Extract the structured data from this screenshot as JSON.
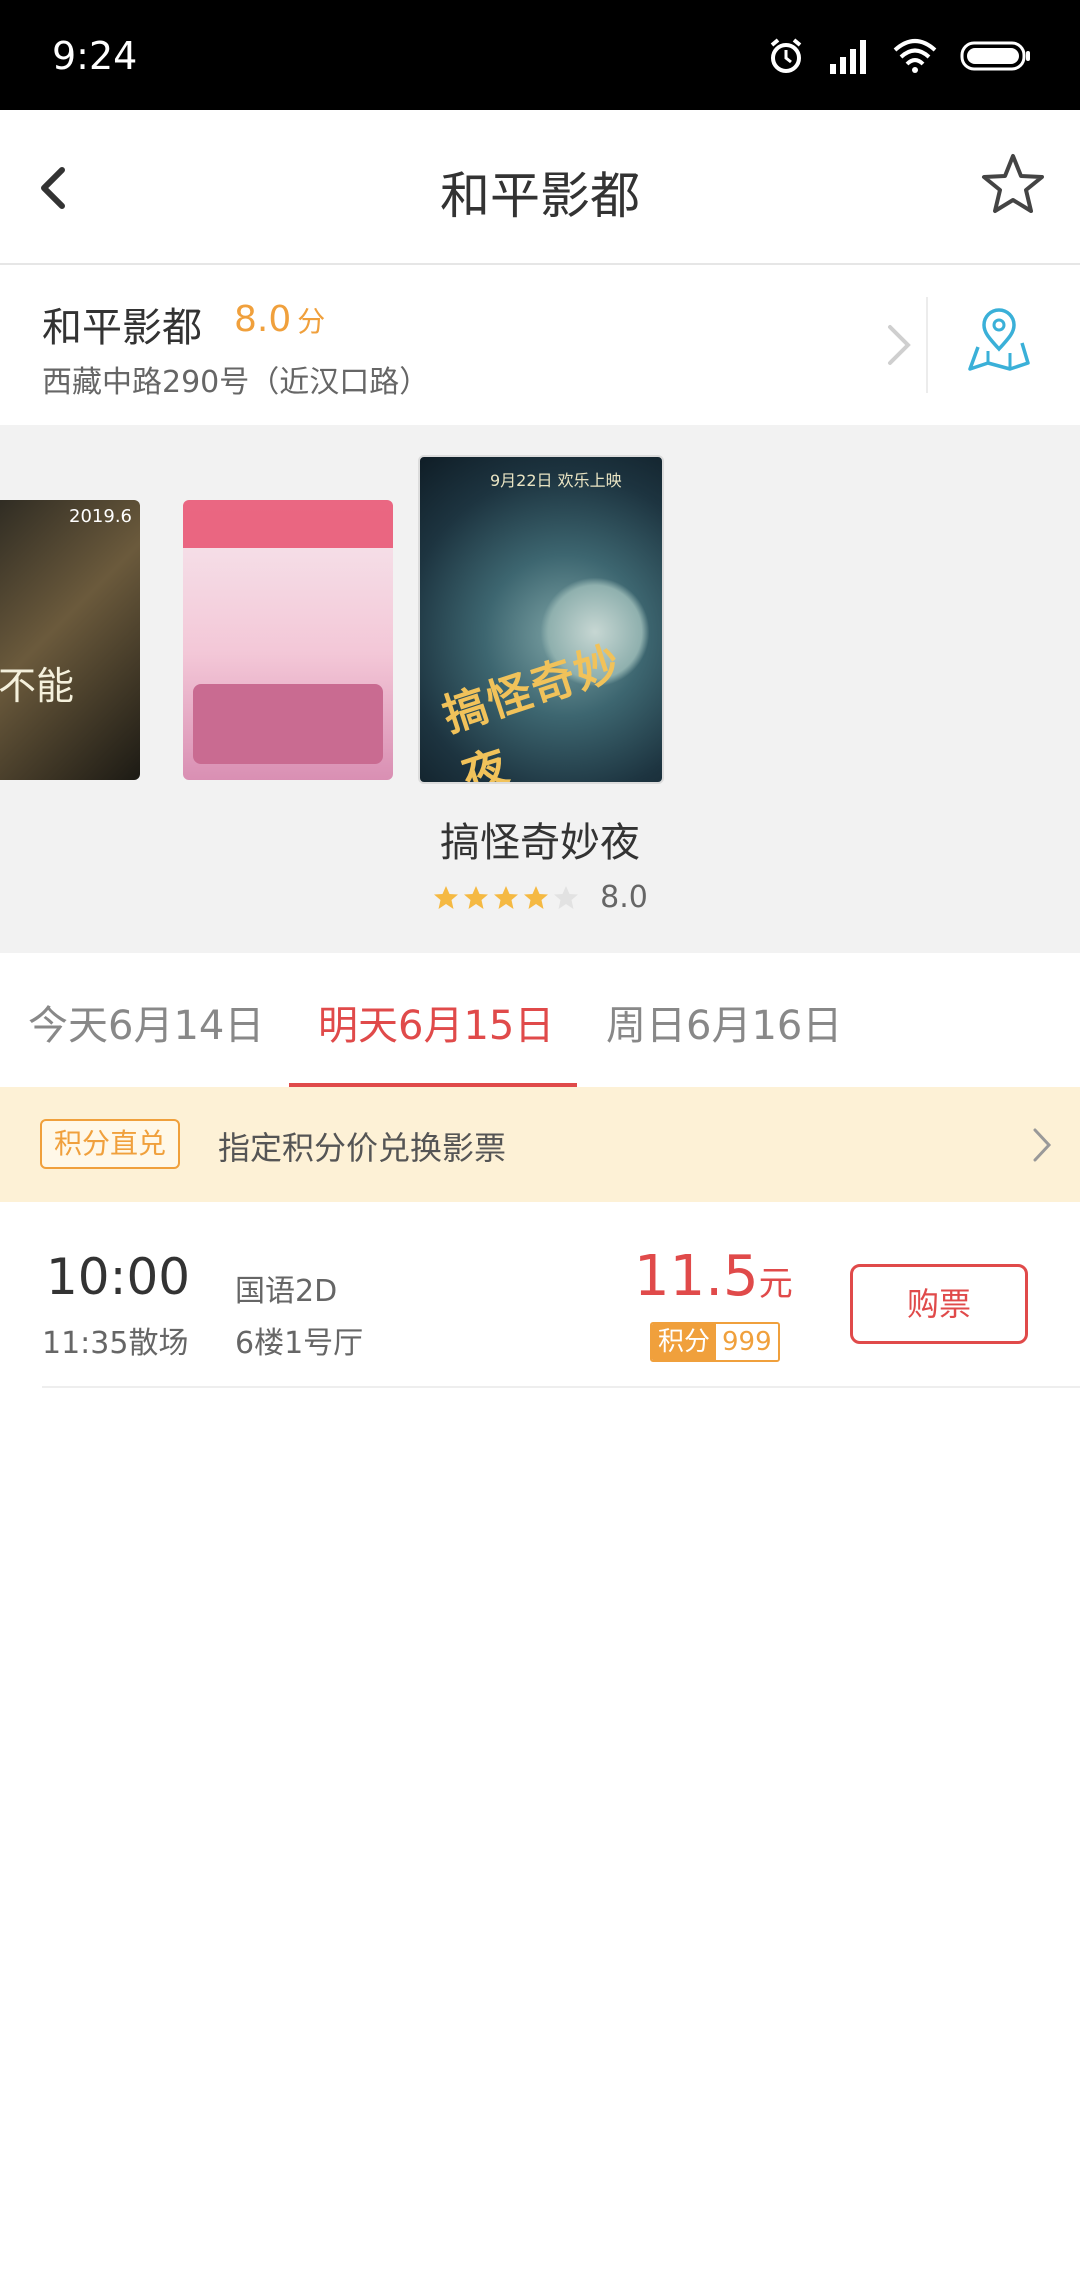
{
  "status_bar": {
    "time": "9:24"
  },
  "nav": {
    "title": "和平影都"
  },
  "cinema": {
    "name": "和平影都",
    "score": "8.0",
    "score_unit": "分",
    "address": "西藏中路290号（近汉口路）"
  },
  "posters": {
    "items": [
      {
        "label_text": "不能",
        "year_text": "2019.6"
      },
      {
        "label_text": ""
      },
      {
        "label_text": "搞怪奇妙夜",
        "date_text": "9月22日 欢乐上映"
      }
    ],
    "selected_title": "搞怪奇妙夜",
    "rating_stars": 4,
    "rating_value": "8.0"
  },
  "date_tabs": [
    {
      "label": "今天6月14日"
    },
    {
      "label": "明天6月15日"
    },
    {
      "label": "周日6月16日"
    }
  ],
  "points_banner": {
    "badge": "积分直兑",
    "text": "指定积分价兑换影票"
  },
  "showtimes": [
    {
      "start": "10:00",
      "end": "11:35散场",
      "language": "国语2D",
      "hall": "6楼1号厅",
      "price": "11.5",
      "price_unit": "元",
      "points_label": "积分",
      "points_value": "999",
      "buy_label": "购票"
    }
  ],
  "colors": {
    "accent_red": "#e04a4a",
    "accent_orange": "#f0a03c",
    "map_icon": "#3ab0d8",
    "banner_bg": "#fdf1d6"
  }
}
